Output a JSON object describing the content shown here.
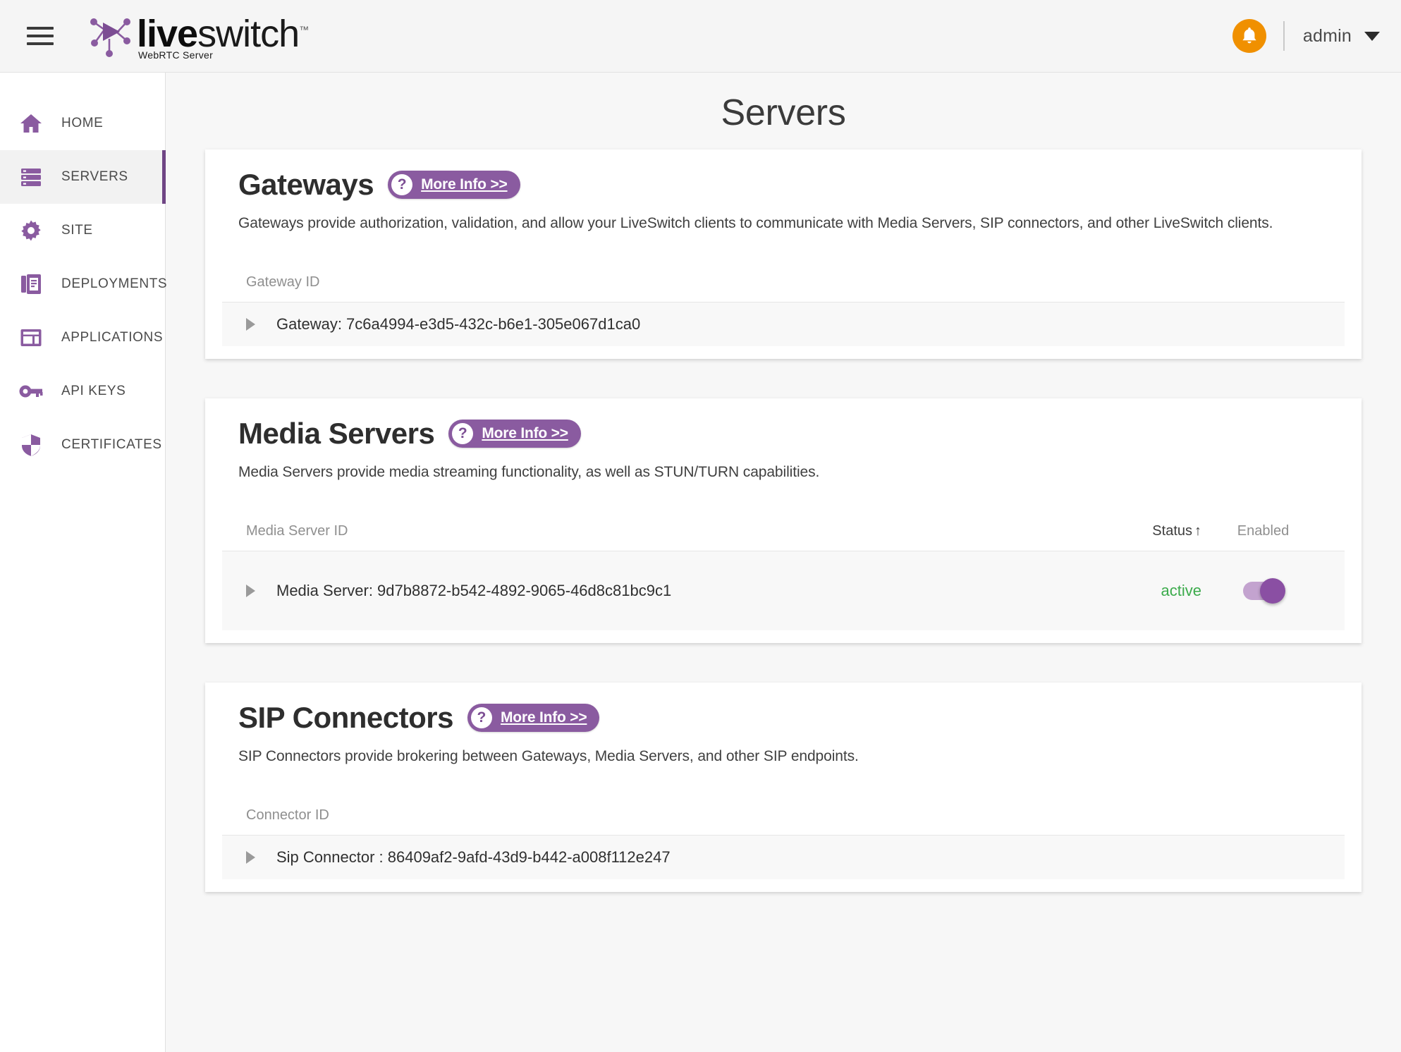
{
  "topbar": {
    "menu_icon": "hamburger-icon",
    "logo_live": "live",
    "logo_switch": "switch",
    "logo_tm": "™",
    "logo_subtitle": "WebRTC Server",
    "notification_icon": "bell-icon",
    "user_name": "admin",
    "user_caret_icon": "chevron-down-icon"
  },
  "sidebar": {
    "items": [
      {
        "label": "HOME",
        "icon": "home-icon",
        "active": false
      },
      {
        "label": "SERVERS",
        "icon": "servers-icon",
        "active": true
      },
      {
        "label": "SITE",
        "icon": "gear-icon",
        "active": false
      },
      {
        "label": "DEPLOYMENTS",
        "icon": "documents-icon",
        "active": false
      },
      {
        "label": "APPLICATIONS",
        "icon": "layout-icon",
        "active": false
      },
      {
        "label": "API KEYS",
        "icon": "key-icon",
        "active": false
      },
      {
        "label": "CERTIFICATES",
        "icon": "shield-icon",
        "active": false
      }
    ]
  },
  "main": {
    "page_title": "Servers",
    "sections": [
      {
        "title": "Gateways",
        "more_info_label": "More Info >>",
        "help_glyph": "?",
        "description": "Gateways provide authorization, validation, and allow your LiveSwitch clients to communicate with Media Servers, SIP connectors, and other LiveSwitch clients.",
        "columns": {
          "id": "Gateway ID",
          "status": "",
          "enabled": ""
        },
        "has_status_column": false,
        "rows": [
          {
            "id": "Gateway: 7c6a4994-e3d5-432c-b6e1-305e067d1ca0",
            "status": "",
            "enabled": false
          }
        ]
      },
      {
        "title": "Media Servers",
        "more_info_label": "More Info >>",
        "help_glyph": "?",
        "description": "Media Servers provide media streaming functionality, as well as STUN/TURN capabilities.",
        "columns": {
          "id": "Media Server ID",
          "status": "Status",
          "sort_arrow": "↑",
          "enabled": "Enabled"
        },
        "has_status_column": true,
        "rows": [
          {
            "id": "Media Server: 9d7b8872-b542-4892-9065-46d8c81bc9c1",
            "status": "active",
            "enabled": true
          }
        ]
      },
      {
        "title": "SIP Connectors",
        "more_info_label": "More Info >>",
        "help_glyph": "?",
        "description": "SIP Connectors provide brokering between Gateways, Media Servers, and other SIP endpoints.",
        "columns": {
          "id": "Connector ID",
          "status": "",
          "enabled": ""
        },
        "has_status_column": false,
        "rows": [
          {
            "id": "Sip Connector : 86409af2-9afd-43d9-b442-a008f112e247",
            "status": "",
            "enabled": false
          }
        ]
      }
    ]
  },
  "colors": {
    "brand_purple": "#6f4585",
    "badge_purple": "#8a5ba0",
    "accent_orange": "#f09000",
    "status_green": "#3cab4c"
  }
}
